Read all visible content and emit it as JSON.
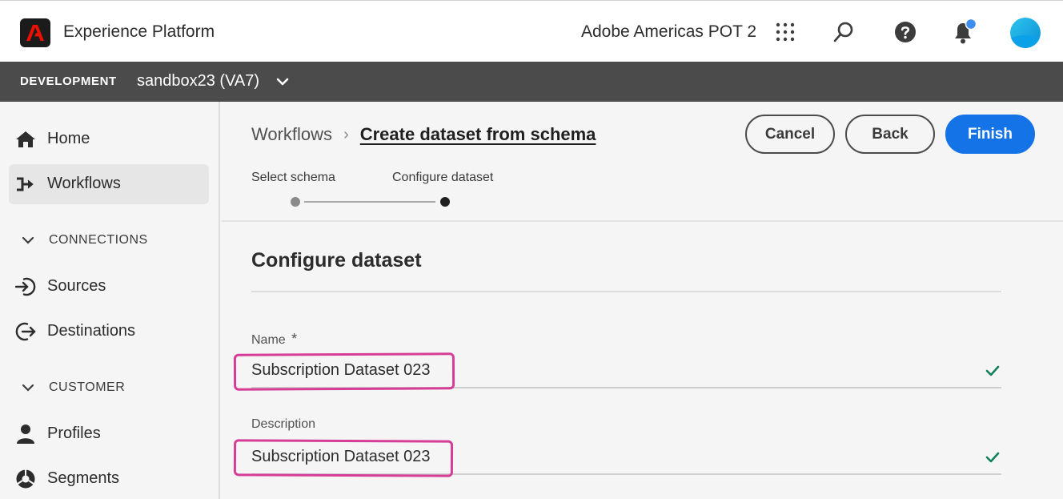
{
  "app": {
    "title": "Experience Platform",
    "org": "Adobe Americas POT 2"
  },
  "sandbox": {
    "env": "DEVELOPMENT",
    "name": "sandbox23 (VA7)"
  },
  "sidebar": {
    "items": [
      {
        "label": "Home",
        "icon": "home-icon"
      },
      {
        "label": "Workflows",
        "icon": "workflows-icon",
        "active": true
      }
    ],
    "sections": [
      {
        "title": "CONNECTIONS",
        "items": [
          {
            "label": "Sources",
            "icon": "sources-icon"
          },
          {
            "label": "Destinations",
            "icon": "destinations-icon"
          }
        ]
      },
      {
        "title": "CUSTOMER",
        "items": [
          {
            "label": "Profiles",
            "icon": "profiles-icon"
          },
          {
            "label": "Segments",
            "icon": "segments-icon"
          }
        ]
      }
    ]
  },
  "breadcrumb": {
    "root": "Workflows",
    "current": "Create dataset from schema"
  },
  "actions": {
    "cancel": "Cancel",
    "back": "Back",
    "finish": "Finish"
  },
  "steps": [
    {
      "label": "Select schema",
      "state": "completed"
    },
    {
      "label": "Configure dataset",
      "state": "current"
    }
  ],
  "form": {
    "title": "Configure dataset",
    "name_label": "Name",
    "name_required_mark": "*",
    "name_value": "Subscription Dataset 023",
    "description_label": "Description",
    "description_value": "Subscription Dataset 023"
  },
  "colors": {
    "accent": "#1473e6",
    "highlight": "#d63d96",
    "valid": "#12805c",
    "sandbox_bar": "#4b4b4b"
  }
}
